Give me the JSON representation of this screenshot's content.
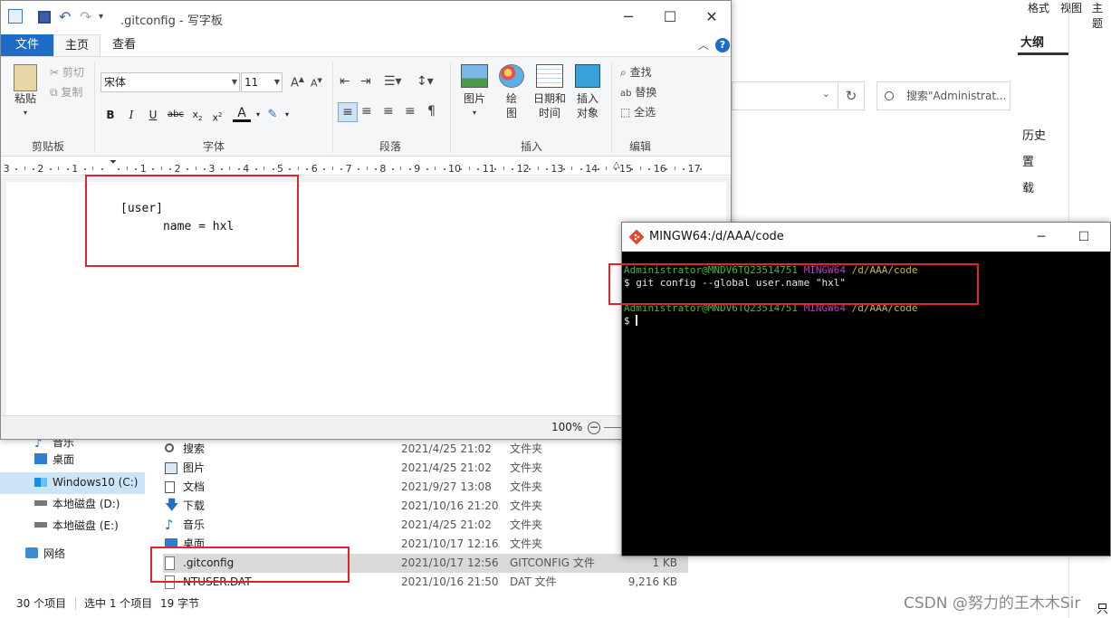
{
  "background_app": {
    "menu_format": "格式",
    "menu_view": "视图",
    "menu_theme": "主题",
    "outline": "大纲",
    "side_items": [
      "历史",
      "置",
      "载"
    ]
  },
  "explorer": {
    "search_placeholder": "搜索\"Administrat...",
    "nav": [
      {
        "label": "音乐",
        "icon": "music-icon"
      },
      {
        "label": "桌面",
        "icon": "desktop-folder-icon"
      },
      {
        "label": "Windows10 (C:)",
        "icon": "windows-drive-icon",
        "selected": true
      },
      {
        "label": "本地磁盘 (D:)",
        "icon": "drive-icon"
      },
      {
        "label": "本地磁盘 (E:)",
        "icon": "drive-icon"
      },
      {
        "label": "网络",
        "icon": "network-icon"
      }
    ],
    "files": [
      {
        "name": "搜索",
        "date": "2021/4/25 21:02",
        "type": "文件夹",
        "size": "",
        "icon": "search-folder-icon"
      },
      {
        "name": "图片",
        "date": "2021/4/25 21:02",
        "type": "文件夹",
        "size": "",
        "icon": "pictures-folder-icon"
      },
      {
        "name": "文档",
        "date": "2021/9/27 13:08",
        "type": "文件夹",
        "size": "",
        "icon": "documents-folder-icon"
      },
      {
        "name": "下载",
        "date": "2021/10/16 21:20",
        "type": "文件夹",
        "size": "",
        "icon": "downloads-folder-icon"
      },
      {
        "name": "音乐",
        "date": "2021/4/25 21:02",
        "type": "文件夹",
        "size": "",
        "icon": "music-folder-icon"
      },
      {
        "name": "桌面",
        "date": "2021/10/17 12:16",
        "type": "文件夹",
        "size": "",
        "icon": "desktop-folder-icon"
      },
      {
        "name": ".gitconfig",
        "date": "2021/10/17 12:56",
        "type": "GITCONFIG 文件",
        "size": "1 KB",
        "icon": "file-icon",
        "selected": true
      },
      {
        "name": "NTUSER.DAT",
        "date": "2021/10/16 21:50",
        "type": "DAT 文件",
        "size": "9,216 KB",
        "icon": "file-icon"
      }
    ],
    "status": {
      "count": "30 个项目",
      "selected": "选中 1 个项目",
      "size": "19 字节"
    }
  },
  "wordpad": {
    "title": ".gitconfig - 写字板",
    "tabs": {
      "file": "文件",
      "home": "主页",
      "view": "查看"
    },
    "clipboard": {
      "paste": "粘贴",
      "cut": "剪切",
      "copy": "复制",
      "label": "剪贴板"
    },
    "font": {
      "family": "宋体",
      "size": "11",
      "label": "字体"
    },
    "paragraph": {
      "label": "段落"
    },
    "insert": {
      "picture": "图片",
      "paint_1": "绘",
      "paint_2": "图",
      "datetime_1": "日期和",
      "datetime_2": "时间",
      "object_1": "插入",
      "object_2": "对象",
      "label": "插入"
    },
    "edit": {
      "find": "查找",
      "replace": "替换",
      "select_all": "全选",
      "label": "编辑"
    },
    "ruler": [
      "3",
      "2",
      "1",
      "1",
      "2",
      "3",
      "4",
      "5",
      "6",
      "7",
      "8",
      "9",
      "10",
      "11",
      "12",
      "13",
      "14",
      "15",
      "16",
      "17"
    ],
    "document_text": "[user]\n      name = hxl",
    "zoom": "100%"
  },
  "terminal": {
    "title": "MINGW64:/d/AAA/code",
    "prompt_user": "Administrator@MNDV6TQ23514751",
    "prompt_env": "MINGW64",
    "prompt_path": "/d/AAA/code",
    "command": "$ git config --global user.name \"hxl\"",
    "prompt_symbol": "$ "
  },
  "watermark": "CSDN @努力的王木木Sir",
  "corner_char": "只"
}
